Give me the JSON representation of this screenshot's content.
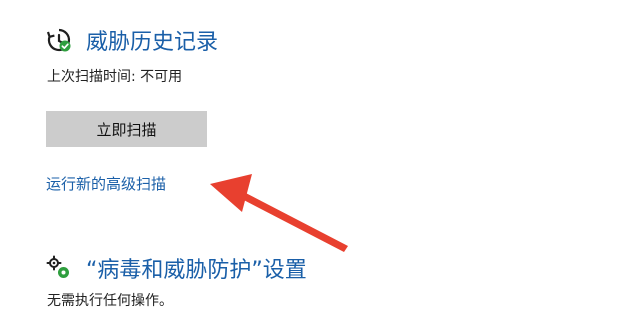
{
  "threat_history": {
    "title": "威胁历史记录",
    "icon": "history-clock-icon",
    "last_scan_label": "上次扫描时间",
    "last_scan_separator": ":",
    "last_scan_value": "不可用",
    "scan_now_button": "立即扫描",
    "advanced_scan_link": "运行新的高级扫描"
  },
  "protection_settings": {
    "title": "“病毒和威胁防护”设置",
    "icon": "settings-gears-icon",
    "status_text": "无需执行任何操作。"
  },
  "annotation": {
    "arrow_color": "#e8402f"
  },
  "colors": {
    "accent": "#1a5fa8",
    "button_bg": "#cccccc"
  }
}
